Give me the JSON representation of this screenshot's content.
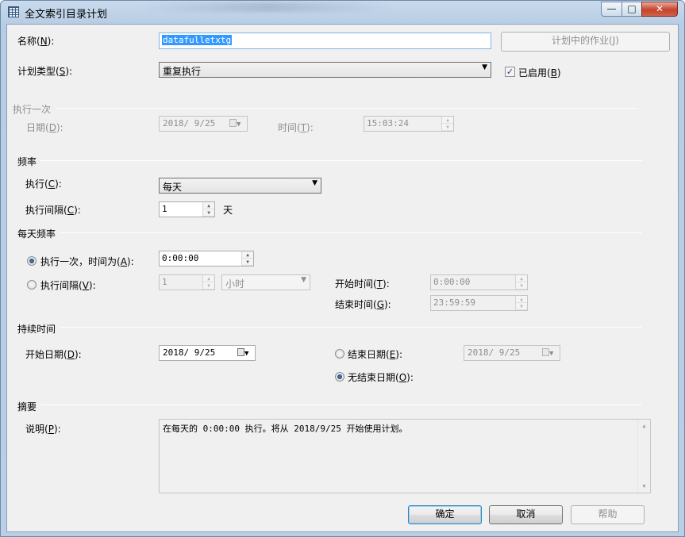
{
  "window": {
    "title": "全文索引目录计划",
    "minimize_glyph": "—",
    "maximize_glyph": "□",
    "close_glyph": "✕"
  },
  "name_row": {
    "label": "名称(",
    "accel": "N",
    "label_end": "):",
    "value": "datafulletxtg",
    "jobs_button": "计划中的作业(J)"
  },
  "schedule_type": {
    "label": "计划类型(",
    "accel": "S",
    "label_end": "):",
    "value": "重复执行",
    "enabled_label": "已启用(",
    "enabled_accel": "B",
    "enabled_end": ")",
    "enabled": true
  },
  "once": {
    "section": "执行一次",
    "date_label": "日期(",
    "date_accel": "D",
    "date_end": "):",
    "date_value": "2018/ 9/25",
    "time_label": "时间(",
    "time_accel": "T",
    "time_end": "):",
    "time_value": "15:03:24"
  },
  "frequency": {
    "section": "频率",
    "occurs_label": "执行(",
    "occurs_accel": "C",
    "occurs_end": "):",
    "occurs_value": "每天",
    "recurs_label": "执行间隔(",
    "recurs_accel": "C",
    "recurs_end": "):",
    "recurs_value": "1",
    "recurs_unit": "天"
  },
  "daily": {
    "section": "每天频率",
    "once_label": "执行一次，时间为(",
    "once_accel": "A",
    "once_end": "):",
    "once_value": "0:00:00",
    "once_selected": true,
    "every_label": "执行间隔(",
    "every_accel": "V",
    "every_end": "):",
    "every_value": "1",
    "every_unit": "小时",
    "start_label": "开始时间(",
    "start_accel": "T",
    "start_end": "):",
    "start_value": "0:00:00",
    "end_label": "结束时间(",
    "end_accel": "G",
    "end_end": "):",
    "end_value": "23:59:59"
  },
  "duration": {
    "section": "持续时间",
    "start_label": "开始日期(",
    "start_accel": "D",
    "start_end": "):",
    "start_value": "2018/ 9/25",
    "end_date_label": "结束日期(",
    "end_date_accel": "E",
    "end_date_end": "):",
    "end_date_value": "2018/ 9/25",
    "no_end_label": "无结束日期(",
    "no_end_accel": "O",
    "no_end_end": "):",
    "no_end_selected": true
  },
  "summary": {
    "section": "摘要",
    "desc_label": "说明(",
    "desc_accel": "P",
    "desc_end": "):",
    "desc_value": "在每天的 0:00:00 执行。将从 2018/9/25 开始使用计划。"
  },
  "buttons": {
    "ok": "确定",
    "cancel": "取消",
    "help": "帮助"
  },
  "icons": {
    "dropdown": "▼",
    "spin_up": "▲",
    "spin_down": "▼",
    "check": "✓"
  }
}
